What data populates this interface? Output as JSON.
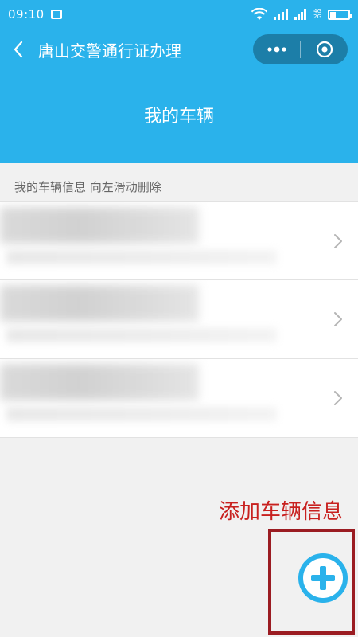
{
  "status_bar": {
    "time": "09:10",
    "network_top": "4G",
    "network_bottom": "2G"
  },
  "nav": {
    "title": "唐山交警通行证办理"
  },
  "page": {
    "heading": "我的车辆"
  },
  "vehicles": {
    "section_title": "我的车辆信息 向左滑动删除",
    "items": [
      {
        "blurred": true
      },
      {
        "blurred": true
      },
      {
        "blurred": true
      }
    ]
  },
  "annotation": {
    "label": "添加车辆信息"
  },
  "colors": {
    "header": "#2ab2eb",
    "capsule": "#1c7ea8",
    "annotation": "#c8211f",
    "add_button": "#2ab2eb"
  }
}
